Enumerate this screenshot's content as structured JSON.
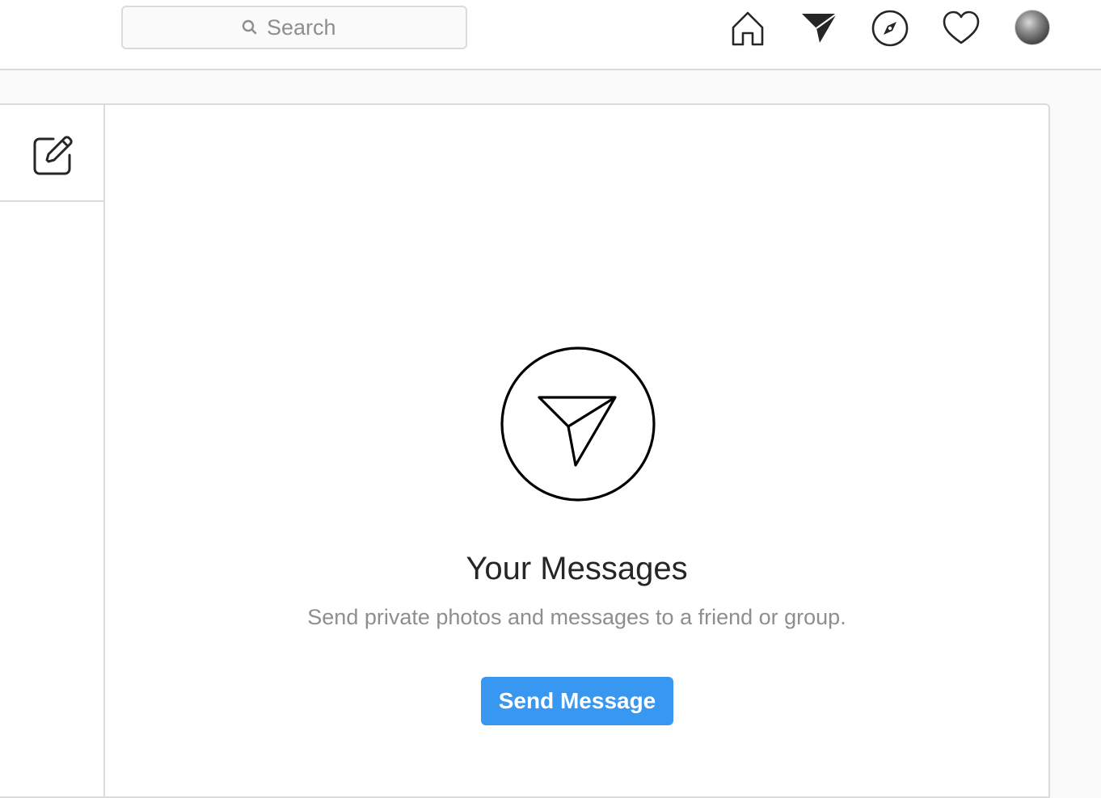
{
  "header": {
    "search": {
      "placeholder": "Search",
      "value": "",
      "icon": "search-icon"
    },
    "nav": [
      {
        "name": "home",
        "icon": "home-icon"
      },
      {
        "name": "direct",
        "icon": "paper-plane-icon",
        "active": true
      },
      {
        "name": "explore",
        "icon": "compass-icon"
      },
      {
        "name": "activity",
        "icon": "heart-icon"
      },
      {
        "name": "profile",
        "icon": "avatar"
      }
    ]
  },
  "sidebar": {
    "compose_icon": "edit-icon"
  },
  "empty_state": {
    "icon": "paper-plane-circle-icon",
    "title": "Your Messages",
    "subtitle": "Send private photos and messages to a friend or group.",
    "button_label": "Send Message"
  },
  "colors": {
    "accent": "#3897f0",
    "border": "#dbdbdb",
    "text_primary": "#262626",
    "text_secondary": "#8e8e8e",
    "background": "#fafafa"
  }
}
